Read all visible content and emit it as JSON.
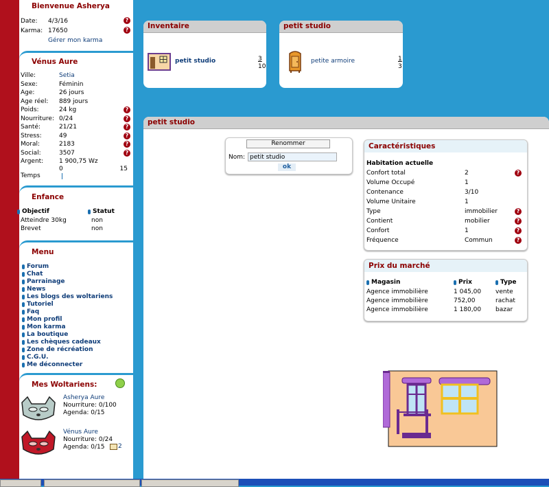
{
  "welcome": {
    "title": "Bienvenue Asherya",
    "date_label": "Date:",
    "date_value": "4/3/16",
    "karma_label": "Karma:",
    "karma_value": "17650",
    "manage_karma": "Gérer mon karma"
  },
  "character": {
    "name": "Vénus Aure",
    "stats": [
      {
        "label": "Ville:",
        "value": "Setia",
        "link": true,
        "help": false
      },
      {
        "label": "Sexe:",
        "value": "Féminin",
        "link": false,
        "help": false
      },
      {
        "label": "Age:",
        "value": "26 jours",
        "link": false,
        "help": false
      },
      {
        "label": "Age réel:",
        "value": "889 jours",
        "link": false,
        "help": false
      },
      {
        "label": "Poids:",
        "value": "24 kg",
        "link": false,
        "help": true
      },
      {
        "label": "Nourriture:",
        "value": "0/24",
        "link": false,
        "help": true
      },
      {
        "label": "Santé:",
        "value": "21/21",
        "link": false,
        "help": true
      },
      {
        "label": "Stress:",
        "value": "49",
        "link": false,
        "help": true
      },
      {
        "label": "Moral:",
        "value": "2183",
        "link": false,
        "help": true
      },
      {
        "label": "Social:",
        "value": "3507",
        "link": false,
        "help": true
      },
      {
        "label": "Argent:",
        "value": "1 900,75 Wz",
        "link": false,
        "help": false
      }
    ],
    "time_label": "Temps",
    "time_min": "0",
    "time_max": "15"
  },
  "childhood": {
    "title": "Enfance",
    "col_objective": "Objectif",
    "col_status": "Statut",
    "rows": [
      {
        "objective": "Atteindre 30kg",
        "status": "non"
      },
      {
        "objective": "Brevet",
        "status": "non"
      }
    ]
  },
  "menu": {
    "title": "Menu",
    "items": [
      "Forum",
      "Chat",
      "Parrainage",
      "News",
      "Les blogs des woltariens",
      "Tutoriel",
      "Faq",
      "Mon profil",
      "Mon karma",
      "La boutique",
      "Les chèques cadeaux",
      "Zone de récréation",
      "C.G.U.",
      "Me déconnecter"
    ]
  },
  "woltariens": {
    "title": "Mes Woltariens:",
    "list": [
      {
        "name": "Asherya Aure",
        "food": "Nourriture: 0/100",
        "agenda": "Agenda: 0/15",
        "mail_count": ""
      },
      {
        "name": "Vénus Aure",
        "food": "Nourriture: 0/24",
        "agenda": "Agenda: 0/15",
        "mail_count": "2"
      }
    ]
  },
  "inventory": {
    "title": "Inventaire",
    "item_name": "petit studio",
    "count_top": "3",
    "count_bottom": "10"
  },
  "studio_panel": {
    "title": "petit studio",
    "item_name": "petite armoire",
    "count_top": "1",
    "count_bottom": "3"
  },
  "main": {
    "title": "petit studio",
    "rename": {
      "button": "Renommer",
      "label": "Nom:",
      "value": "petit studio",
      "ok": "ok"
    },
    "characteristics": {
      "title": "Caractéristiques",
      "subtitle": "Habitation actuelle",
      "rows": [
        {
          "label": "Confort total",
          "value": "2",
          "help": true
        },
        {
          "label": "Volume Occupé",
          "value": "1",
          "help": false
        },
        {
          "label": "Contenance",
          "value": "3/10",
          "help": false
        },
        {
          "label": "Volume Unitaire",
          "value": "1",
          "help": false
        },
        {
          "label": "Type",
          "value": "immobilier",
          "help": true
        },
        {
          "label": "Contient",
          "value": "mobilier",
          "help": true
        },
        {
          "label": "Confort",
          "value": "1",
          "help": true
        },
        {
          "label": "Fréquence",
          "value": "Commun",
          "help": true
        }
      ]
    },
    "market": {
      "title": "Prix du marché",
      "col_shop": "Magasin",
      "col_price": "Prix",
      "col_type": "Type",
      "rows": [
        {
          "shop": "Agence immobilière",
          "price": "1 045,00",
          "type": "vente"
        },
        {
          "shop": "Agence immobilière",
          "price": "752,00",
          "type": "rachat"
        },
        {
          "shop": "Agence immobilière",
          "price": "1 180,00",
          "type": "bazar"
        }
      ]
    }
  },
  "help_glyph": "?",
  "colors": {
    "background": "#2a9ad0",
    "accent_red": "#8b0000",
    "link_blue": "#0e3c78",
    "sidebar_strip": "#b0101c"
  }
}
